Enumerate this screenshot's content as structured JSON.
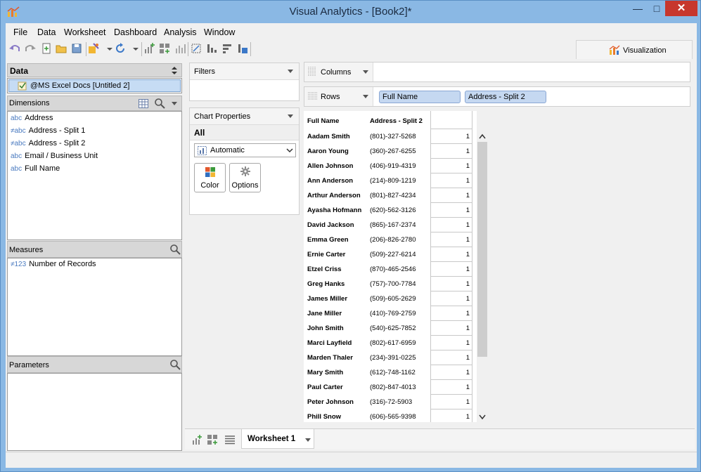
{
  "window": {
    "title": "Visual Analytics - [Book2]*",
    "minimize": "—",
    "maximize": "□",
    "close": "✕"
  },
  "menu": [
    "File",
    "Data",
    "Worksheet",
    "Dashboard",
    "Analysis",
    "Window"
  ],
  "viz_tab": {
    "label": "Visualization"
  },
  "data_panel": {
    "header": "Data",
    "source": "@MS Excel Docs [Untitled 2]"
  },
  "dimensions": {
    "header": "Dimensions",
    "items": [
      {
        "type": "abc",
        "label": "Address"
      },
      {
        "type": "≠abc",
        "label": "Address - Split 1"
      },
      {
        "type": "≠abc",
        "label": "Address - Split 2"
      },
      {
        "type": "abc",
        "label": "Email / Business Unit"
      },
      {
        "type": "abc",
        "label": "Full Name"
      }
    ]
  },
  "measures": {
    "header": "Measures",
    "items": [
      {
        "type": "≠123",
        "label": "Number of Records"
      }
    ]
  },
  "parameters": {
    "header": "Parameters"
  },
  "filters": {
    "header": "Filters"
  },
  "chart_properties": {
    "header": "Chart Properties",
    "all_label": "All",
    "mark_type": "Automatic",
    "color_button": "Color",
    "options_button": "Options"
  },
  "shelves": {
    "columns_label": "Columns",
    "rows_label": "Rows",
    "rows_pills": [
      "Full Name",
      "Address - Split 2"
    ]
  },
  "table": {
    "headers": [
      "Full Name",
      "Address - Split 2"
    ],
    "rows": [
      [
        "Aadam Smith",
        "(801)-327-5268",
        "1"
      ],
      [
        "Aaron Young",
        "(360)-267-6255",
        "1"
      ],
      [
        "Allen Johnson",
        "(406)-919-4319",
        "1"
      ],
      [
        "Ann Anderson",
        "(214)-809-1219",
        "1"
      ],
      [
        "Arthur Anderson",
        "(801)-827-4234",
        "1"
      ],
      [
        "Ayasha Hofmann",
        "(620)-562-3126",
        "1"
      ],
      [
        "David Jackson",
        "(865)-167-2374",
        "1"
      ],
      [
        "Emma Green",
        "(206)-826-2780",
        "1"
      ],
      [
        "Ernie Carter",
        "(509)-227-6214",
        "1"
      ],
      [
        "Etzel Criss",
        "(870)-465-2546",
        "1"
      ],
      [
        "Greg Hanks",
        "(757)-700-7784",
        "1"
      ],
      [
        "James Miller",
        "(509)-605-2629",
        "1"
      ],
      [
        "Jane Miller",
        "(410)-769-2759",
        "1"
      ],
      [
        "John Smith",
        "(540)-625-7852",
        "1"
      ],
      [
        "Marci Layfield",
        "(802)-617-6959",
        "1"
      ],
      [
        "Marden Thaler",
        "(234)-391-0225",
        "1"
      ],
      [
        "Mary Smith",
        "(612)-748-1162",
        "1"
      ],
      [
        "Paul Carter",
        "(802)-847-4013",
        "1"
      ],
      [
        "Peter Johnson",
        "(316)-72-5903",
        "1"
      ],
      [
        "Phill Snow",
        "(606)-565-9398",
        "1"
      ]
    ]
  },
  "sheet_tab": {
    "label": "Worksheet 1"
  }
}
